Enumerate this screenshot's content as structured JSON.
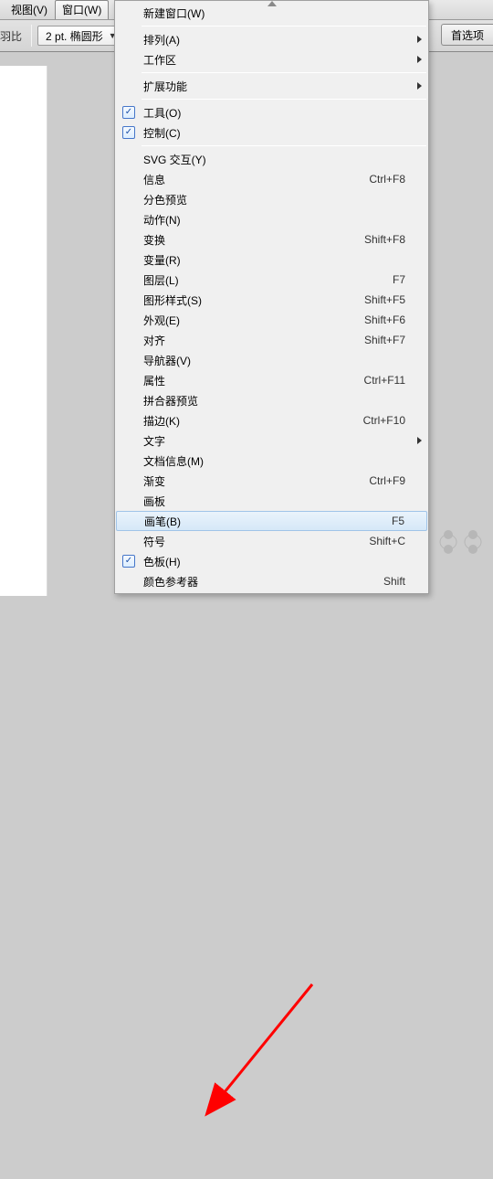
{
  "menubar": {
    "items": [
      {
        "label": "视图(V)",
        "open": false
      },
      {
        "label": "窗口(W)",
        "open": true
      }
    ]
  },
  "toolbar": {
    "left_label": "羽比",
    "dropdown_value": "2 pt. 椭圆形",
    "pref_button": "首选项"
  },
  "menu": {
    "items": [
      {
        "label": "新建窗口(W)"
      },
      {
        "sep": true
      },
      {
        "label": "排列(A)",
        "submenu": true
      },
      {
        "label": "工作区",
        "submenu": true
      },
      {
        "sep": true
      },
      {
        "label": "扩展功能",
        "submenu": true
      },
      {
        "sep": true
      },
      {
        "label": "工具(O)",
        "checked": true
      },
      {
        "label": "控制(C)",
        "checked": true
      },
      {
        "sep": true
      },
      {
        "label": "SVG 交互(Y)"
      },
      {
        "label": "信息",
        "shortcut": "Ctrl+F8"
      },
      {
        "label": "分色预览"
      },
      {
        "label": "动作(N)"
      },
      {
        "label": "变换",
        "shortcut": "Shift+F8"
      },
      {
        "label": "变量(R)"
      },
      {
        "label": "图层(L)",
        "shortcut": "F7"
      },
      {
        "label": "图形样式(S)",
        "shortcut": "Shift+F5"
      },
      {
        "label": "外观(E)",
        "shortcut": "Shift+F6"
      },
      {
        "label": "对齐",
        "shortcut": "Shift+F7"
      },
      {
        "label": "导航器(V)"
      },
      {
        "label": "属性",
        "shortcut": "Ctrl+F11"
      },
      {
        "label": "拼合器预览"
      },
      {
        "label": "描边(K)",
        "shortcut": "Ctrl+F10"
      },
      {
        "label": "文字",
        "submenu": true
      },
      {
        "label": "文档信息(M)"
      },
      {
        "label": "渐变",
        "shortcut": "Ctrl+F9"
      },
      {
        "label": "画板"
      },
      {
        "label": "画笔(B)",
        "shortcut": "F5",
        "highlighted": true
      },
      {
        "label": "符号",
        "shortcut": "Shift+C"
      },
      {
        "label": "色板(H)",
        "checked": true
      },
      {
        "label": "颜色参考器",
        "shortcut": "Shift"
      }
    ]
  }
}
